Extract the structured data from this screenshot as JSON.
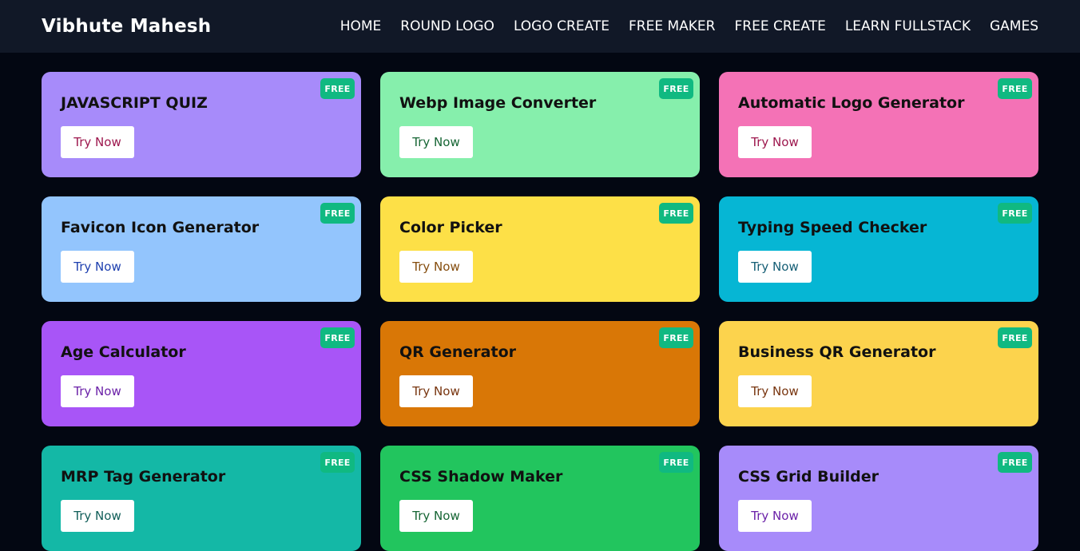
{
  "brand": "Vibhute Mahesh",
  "nav": [
    "HOME",
    "ROUND LOGO",
    "LOGO CREATE",
    "FREE MAKER",
    "FREE CREATE",
    "LEARN FULLSTACK",
    "GAMES"
  ],
  "colors": {
    "page_background": "#030712",
    "navbar_background": "#111827",
    "badge_background": "#10b981"
  },
  "cards": [
    {
      "title": "JAVASCRIPT QUIZ",
      "badge": "FREE",
      "button": "Try Now",
      "bg": "#a78bfa",
      "btn_color": "#9d174d"
    },
    {
      "title": "Webp Image Converter",
      "badge": "FREE",
      "button": "Try Now",
      "bg": "#86efac",
      "btn_color": "#166534"
    },
    {
      "title": "Automatic Logo Generator",
      "badge": "FREE",
      "button": "Try Now",
      "bg": "#f472b6",
      "btn_color": "#9d174d"
    },
    {
      "title": "Favicon Icon Generator",
      "badge": "FREE",
      "button": "Try Now",
      "bg": "#93c5fd",
      "btn_color": "#1e40af"
    },
    {
      "title": "Color Picker",
      "badge": "FREE",
      "button": "Try Now",
      "bg": "#fde047",
      "btn_color": "#854d0e"
    },
    {
      "title": "Typing Speed Checker",
      "badge": "FREE",
      "button": "Try Now",
      "bg": "#06b6d4",
      "btn_color": "#155e75"
    },
    {
      "title": "Age Calculator",
      "badge": "FREE",
      "button": "Try Now",
      "bg": "#a855f7",
      "btn_color": "#6b21a8"
    },
    {
      "title": "QR Generator",
      "badge": "FREE",
      "button": "Try Now",
      "bg": "#d97706",
      "btn_color": "#78350f"
    },
    {
      "title": "Business QR Generator",
      "badge": "FREE",
      "button": "Try Now",
      "bg": "#fcd34d",
      "btn_color": "#78350f"
    },
    {
      "title": "MRP Tag Generator",
      "badge": "FREE",
      "button": "Try Now",
      "bg": "#14b8a6",
      "btn_color": "#115e59"
    },
    {
      "title": "CSS Shadow Maker",
      "badge": "FREE",
      "button": "Try Now",
      "bg": "#22c55e",
      "btn_color": "#166534"
    },
    {
      "title": "CSS Grid Builder",
      "badge": "FREE",
      "button": "Try Now",
      "bg": "#a78bfa",
      "btn_color": "#6b21a8"
    }
  ]
}
